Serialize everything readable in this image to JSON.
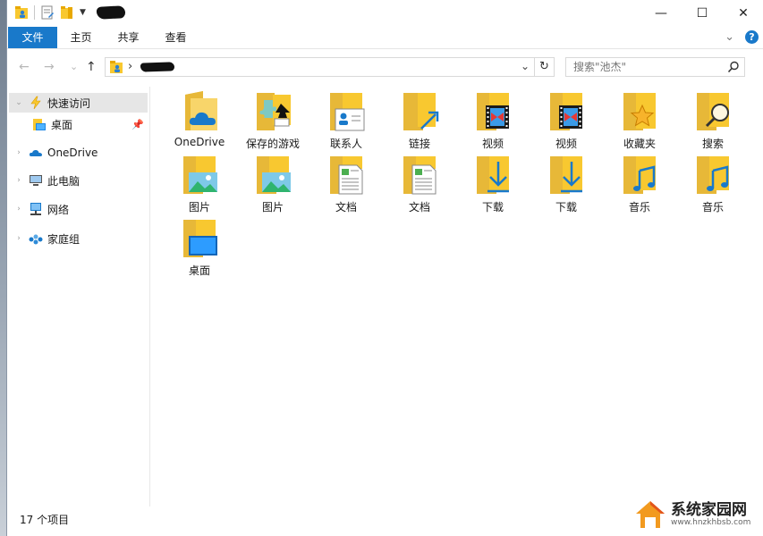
{
  "window": {
    "minimize_glyph": "—",
    "maximize_glyph": "☐",
    "close_glyph": "✕"
  },
  "ribbon": {
    "tabs": [
      "文件",
      "主页",
      "共享",
      "查看"
    ],
    "expand_glyph": "⌄",
    "help_glyph": "?"
  },
  "address": {
    "back_glyph": "←",
    "forward_glyph": "→",
    "recent_glyph": "⌄",
    "up_glyph": "↑",
    "separator": "›",
    "dropdown_glyph": "⌄",
    "refresh_glyph": "↻",
    "search_placeholder": "搜索\"池杰\"",
    "search_icon": "search-icon"
  },
  "nav_pane": {
    "items": [
      {
        "label": "快速访问",
        "icon": "quick-access-icon"
      },
      {
        "label": "桌面",
        "icon": "desktop-folder-icon"
      },
      {
        "label": "OneDrive",
        "icon": "onedrive-icon"
      },
      {
        "label": "此电脑",
        "icon": "this-pc-icon"
      },
      {
        "label": "网络",
        "icon": "network-icon"
      },
      {
        "label": "家庭组",
        "icon": "homegroup-icon"
      }
    ],
    "pin_glyph": "📌"
  },
  "items": [
    {
      "label": "OneDrive",
      "icon": "onedrive-folder-icon"
    },
    {
      "label": "保存的游戏",
      "icon": "saved-games-folder-icon"
    },
    {
      "label": "联系人",
      "icon": "contacts-folder-icon"
    },
    {
      "label": "链接",
      "icon": "links-folder-icon"
    },
    {
      "label": "视频",
      "icon": "videos-folder-icon"
    },
    {
      "label": "视频",
      "icon": "videos-folder-icon"
    },
    {
      "label": "收藏夹",
      "icon": "favorites-folder-icon"
    },
    {
      "label": "搜索",
      "icon": "searches-folder-icon"
    },
    {
      "label": "图片",
      "icon": "pictures-folder-icon"
    },
    {
      "label": "图片",
      "icon": "pictures-folder-icon"
    },
    {
      "label": "文档",
      "icon": "documents-folder-icon"
    },
    {
      "label": "文档",
      "icon": "documents-folder-icon"
    },
    {
      "label": "下载",
      "icon": "downloads-folder-icon"
    },
    {
      "label": "下载",
      "icon": "downloads-folder-icon"
    },
    {
      "label": "音乐",
      "icon": "music-folder-icon"
    },
    {
      "label": "音乐",
      "icon": "music-folder-icon"
    },
    {
      "label": "桌面",
      "icon": "desktop-folder-icon"
    }
  ],
  "status": {
    "item_count": "17 个项目"
  },
  "watermark": {
    "title": "系统家园网",
    "url": "www.hnzkhbsb.com"
  },
  "colors": {
    "accent": "#1979ca",
    "folder": "#f8c830",
    "folder_dark": "#e8a800"
  }
}
